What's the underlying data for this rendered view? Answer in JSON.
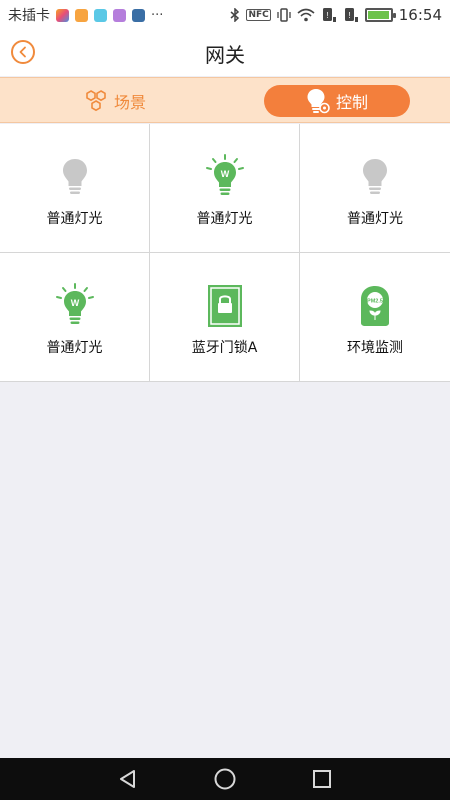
{
  "status_bar": {
    "carrier": "未插卡",
    "more": "···",
    "nfc": "NFC",
    "time": "16:54",
    "battery_level": 0.9
  },
  "header": {
    "title": "网关"
  },
  "tabs": [
    {
      "label": "场景",
      "icon": "hexagon-cluster-icon",
      "active": false
    },
    {
      "label": "控制",
      "icon": "bulb-gear-icon",
      "active": true
    }
  ],
  "devices": [
    {
      "label": "普通灯光",
      "icon": "bulb-off-icon"
    },
    {
      "label": "普通灯光",
      "icon": "bulb-on-icon",
      "badge": "W"
    },
    {
      "label": "普通灯光",
      "icon": "bulb-off-icon"
    },
    {
      "label": "普通灯光",
      "icon": "bulb-on-icon",
      "badge": "W"
    },
    {
      "label": "蓝牙门锁A",
      "icon": "lock-panel-icon"
    },
    {
      "label": "环境监测",
      "icon": "air-monitor-icon",
      "badge": "PM2.5"
    }
  ],
  "colors": {
    "accent": "#f37f3c",
    "tab_bar_bg": "#fde2c9",
    "active_green": "#5cb85c",
    "inactive_gray": "#c8c8c8",
    "nav_bar": "#0d0d0d"
  }
}
